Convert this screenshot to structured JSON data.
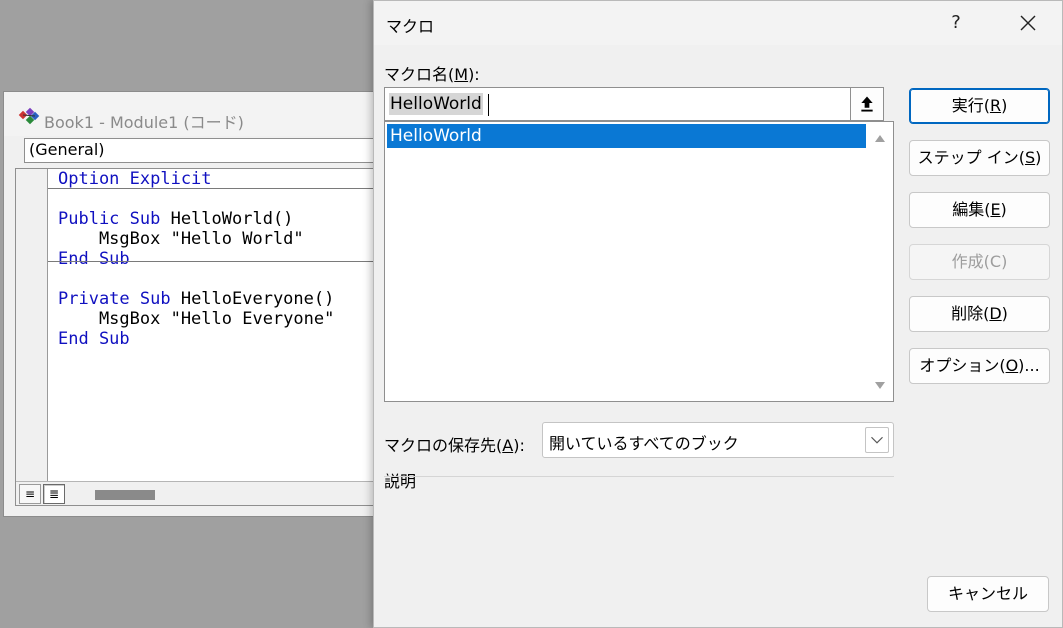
{
  "vba_window": {
    "title": "Book1 - Module1 (コード)",
    "object_dropdown": "(General)",
    "code_lines": [
      [
        {
          "t": "Option Explicit",
          "k": true
        }
      ],
      [
        {
          "t": "",
          "k": false
        }
      ],
      [
        {
          "t": "Public Sub ",
          "k": true
        },
        {
          "t": "HelloWorld()",
          "k": false
        }
      ],
      [
        {
          "t": "    MsgBox \"Hello World\"",
          "k": false
        }
      ],
      [
        {
          "t": "End Sub",
          "k": true
        }
      ],
      [
        {
          "t": "",
          "k": false
        }
      ],
      [
        {
          "t": "Private Sub ",
          "k": true
        },
        {
          "t": "HelloEveryone()",
          "k": false
        }
      ],
      [
        {
          "t": "    MsgBox \"Hello Everyone\"",
          "k": false
        }
      ],
      [
        {
          "t": "End Sub",
          "k": true
        }
      ]
    ],
    "procedure_view_icon": "≡",
    "full_module_view_icon": "≣"
  },
  "macro_dialog": {
    "title": "マクロ",
    "help_label": "?",
    "macro_name_label_pre": "マクロ名(",
    "macro_name_label_key": "M",
    "macro_name_label_post": "):",
    "macro_name_value": "HelloWorld",
    "macro_list": [
      "HelloWorld"
    ],
    "buttons": {
      "run": {
        "pre": "実行(",
        "key": "R",
        "post": ")"
      },
      "step": {
        "pre": "ステップ イン(",
        "key": "S",
        "post": ")"
      },
      "edit": {
        "pre": "編集(",
        "key": "E",
        "post": ")"
      },
      "create": {
        "pre": "作成(",
        "key": "C",
        "post": ")"
      },
      "delete": {
        "pre": "削除(",
        "key": "D",
        "post": ")"
      },
      "options": {
        "pre": "オプション(",
        "key": "O",
        "post": ")..."
      },
      "cancel": "キャンセル"
    },
    "macros_in_label_pre": "マクロの保存先(",
    "macros_in_label_key": "A",
    "macros_in_label_post": "):",
    "macros_in_value": "開いているすべてのブック",
    "description_label": "説明"
  },
  "colors": {
    "selection": "#0a78d4",
    "keyword": "#1010c0",
    "disabled_text": "#9d9d9d"
  }
}
